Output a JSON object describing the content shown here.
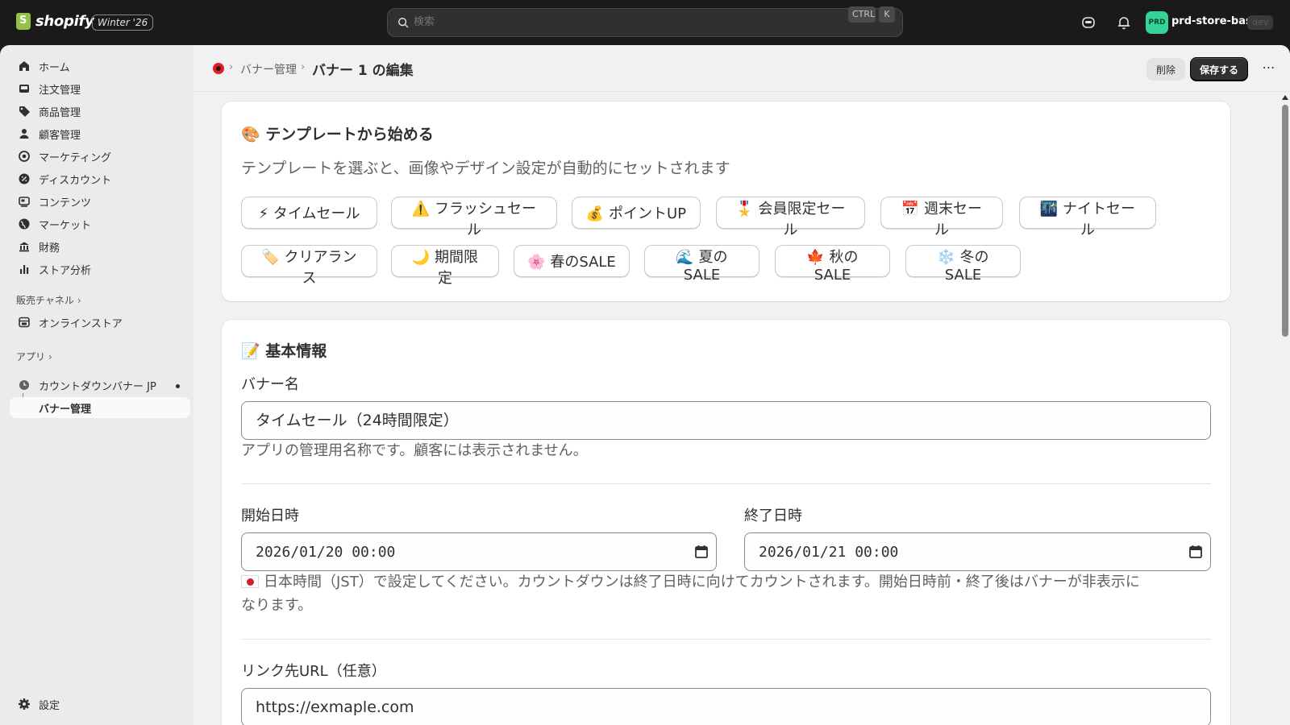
{
  "topbar": {
    "brand": "shopify",
    "edition_badge": "Winter '26",
    "search_placeholder": "検索",
    "shortcut_ctrl": "CTRL",
    "shortcut_key": "K",
    "store_avatar": "PRD",
    "store_name": "prd-store-basic",
    "env_badge": "dev"
  },
  "sidebar": {
    "items": [
      {
        "label": "ホーム",
        "icon": "home-icon"
      },
      {
        "label": "注文管理",
        "icon": "inbox-icon"
      },
      {
        "label": "商品管理",
        "icon": "tag-icon"
      },
      {
        "label": "顧客管理",
        "icon": "person-icon"
      },
      {
        "label": "マーケティング",
        "icon": "target-icon"
      },
      {
        "label": "ディスカウント",
        "icon": "discount-icon"
      },
      {
        "label": "コンテンツ",
        "icon": "content-icon"
      },
      {
        "label": "マーケット",
        "icon": "globe-icon"
      },
      {
        "label": "財務",
        "icon": "bank-icon"
      },
      {
        "label": "ストア分析",
        "icon": "chart-icon"
      }
    ],
    "sales_channels_label": "販売チャネル",
    "online_store": "オンラインストア",
    "apps_label": "アプリ",
    "app_name": "カウントダウンバナー JP",
    "app_sub": "バナー管理",
    "settings": "設定"
  },
  "header": {
    "crumb_link": "バナー管理",
    "title": "バナー 1 の編集",
    "delete_label": "削除",
    "save_label": "保存する",
    "more": "⋯"
  },
  "templates": {
    "title": "🎨 テンプレートから始める",
    "subtitle": "テンプレートを選ぶと、画像やデザイン設定が自動的にセットされます",
    "row1": [
      "⚡ タイムセール",
      "⚠️ フラッシュセール",
      "💰 ポイントUP",
      "🎖️ 会員限定セール",
      "📅 週末セール",
      "🌃 ナイトセール"
    ],
    "row2": [
      "🏷️ クリアランス",
      "🌙 期間限定",
      "🌸 春のSALE",
      "🌊 夏のSALE",
      "🍁 秋のSALE",
      "❄️ 冬のSALE"
    ]
  },
  "basic": {
    "title": "📝 基本情報",
    "name_label": "バナー名",
    "name_value": "タイムセール（24時間限定）",
    "name_help": "アプリの管理用名称です。顧客には表示されません。",
    "start_label": "開始日時",
    "start_value": "2026/01/20  00:00",
    "end_label": "終了日時",
    "end_value": "2026/01/21  00:00",
    "date_help_1": "日本時間（JST）で設定してください。カウントダウンは終了日時に向けてカウントされます。開始日時前・終了後はバナーが非表示に",
    "date_help_2": "なります。",
    "url_label": "リンク先URL（任意）",
    "url_value": "https://exmaple.com"
  }
}
